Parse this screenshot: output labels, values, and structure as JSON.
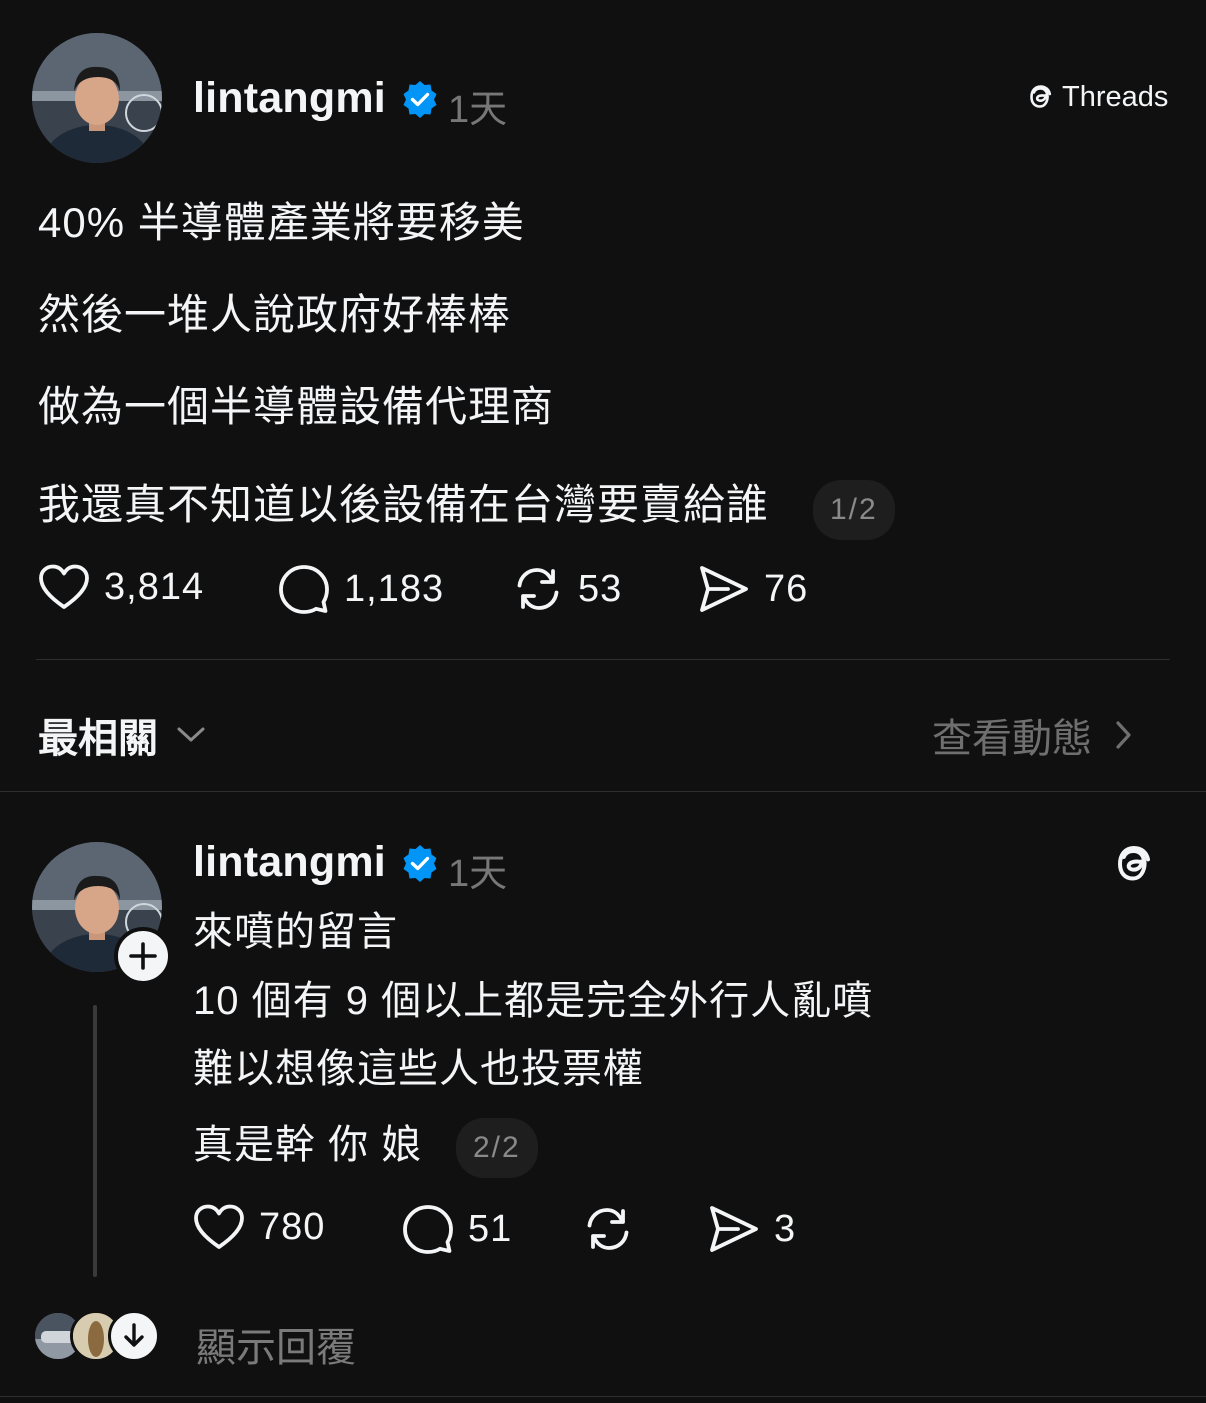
{
  "brand": {
    "label": "Threads"
  },
  "post": {
    "username": "lintangmi",
    "time": "1天",
    "lines": [
      "40% 半導體產業將要移美",
      "然後一堆人說政府好棒棒",
      "做為一個半導體設備代理商",
      "我還真不知道以後設備在台灣要賣給誰"
    ],
    "pager": "1/2",
    "likes": "3,814",
    "comments": "1,183",
    "reposts": "53",
    "shares": "76"
  },
  "sort": {
    "label": "最相關",
    "activity_label": "查看動態"
  },
  "reply": {
    "username": "lintangmi",
    "time": "1天",
    "lines": [
      "來噴的留言",
      "10 個有 9 個以上都是完全外行人亂噴",
      "難以想像這些人也投票權",
      "真是幹 你 娘"
    ],
    "pager": "2/2",
    "likes": "780",
    "comments": "51",
    "reposts": "",
    "shares": "3"
  },
  "show_replies": {
    "label": "顯示回覆"
  },
  "colors": {
    "background": "#101010",
    "text": "#f3f5f7",
    "muted": "#777777",
    "verified": "#0095f6",
    "pager_bg": "#1e1e1e"
  }
}
